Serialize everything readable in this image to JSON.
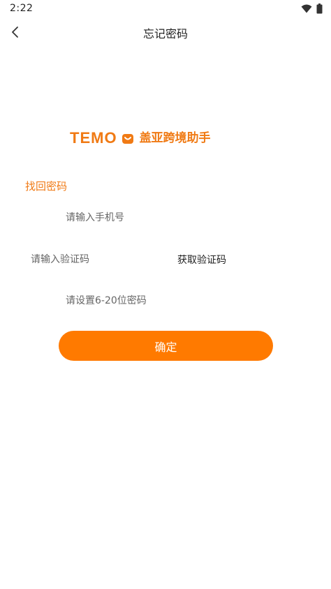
{
  "status_bar": {
    "time": "2:22"
  },
  "appbar": {
    "title": "忘记密码"
  },
  "logo": {
    "brand": "TEMO",
    "name": "盖亚跨境助手"
  },
  "form": {
    "section_title": "找回密码",
    "phone_placeholder": "请输入手机号",
    "code_placeholder": "请输入验证码",
    "get_code_label": "获取验证码",
    "password_placeholder": "请设置6-20位密码",
    "confirm_label": "确定"
  },
  "colors": {
    "accent": "#ff7a00",
    "brand_text": "#f07a14"
  }
}
